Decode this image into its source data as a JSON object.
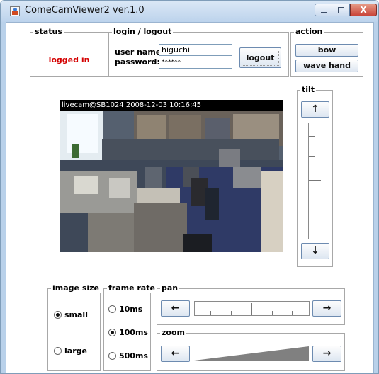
{
  "window": {
    "title": "ComeCamViewer2 ver.1.0",
    "close_glyph": "X"
  },
  "status": {
    "group_title": "status",
    "text": "logged in",
    "text_color": "#d40000"
  },
  "login": {
    "group_title": "login / logout",
    "user_label": "user name:",
    "user_value": "higuchi",
    "password_label": "password:",
    "password_value": "******",
    "logout_label": "logout"
  },
  "action": {
    "group_title": "action",
    "bow_label": "bow",
    "wave_label": "wave hand"
  },
  "camera": {
    "overlay_text": "livecam@SB1024 2008-12-03 10:16:45"
  },
  "tilt": {
    "group_title": "tilt",
    "up_glyph": "↑",
    "down_glyph": "↓"
  },
  "image_size": {
    "group_title": "image size",
    "options": [
      {
        "label": "small",
        "selected": true
      },
      {
        "label": "large",
        "selected": false
      }
    ]
  },
  "frame_rate": {
    "group_title": "frame rate",
    "options": [
      {
        "label": "10ms",
        "selected": false
      },
      {
        "label": "100ms",
        "selected": true
      },
      {
        "label": "500ms",
        "selected": false
      }
    ]
  },
  "pan": {
    "group_title": "pan",
    "left_glyph": "←",
    "right_glyph": "→"
  },
  "zoom": {
    "group_title": "zoom",
    "left_glyph": "←",
    "right_glyph": "→"
  }
}
